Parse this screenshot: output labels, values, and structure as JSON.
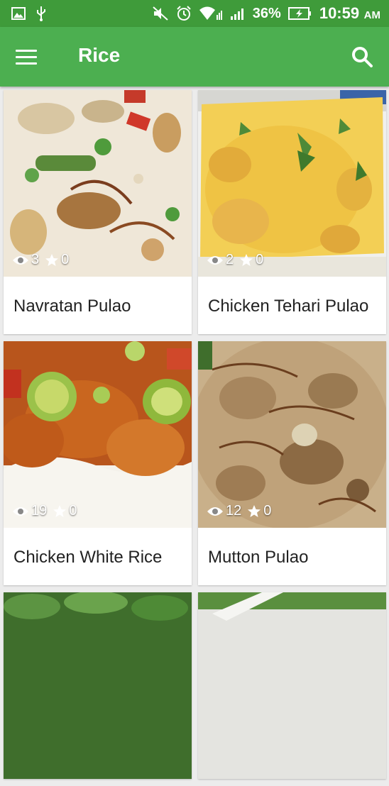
{
  "status_bar": {
    "battery": "36%",
    "time": "10:59",
    "ampm": "AM",
    "icons": [
      "gallery-icon",
      "usb-icon",
      "mute-icon",
      "alarm-icon",
      "wifi-icon",
      "signal-icon",
      "signal-icon",
      "battery-charging-icon"
    ]
  },
  "app_bar": {
    "title": "Rice",
    "menu_icon": "menu-icon",
    "search_icon": "search-icon"
  },
  "theme": {
    "primary": "#4caf50",
    "primary_dark": "#3f9b3a"
  },
  "recipes": [
    {
      "title": "Navratan Pulao",
      "views": "3",
      "rating": "0"
    },
    {
      "title": "Chicken Tehari Pulao",
      "views": "2",
      "rating": "0"
    },
    {
      "title": "Chicken White Rice",
      "views": "19",
      "rating": "0"
    },
    {
      "title": "Mutton Pulao",
      "views": "12",
      "rating": "0"
    }
  ]
}
